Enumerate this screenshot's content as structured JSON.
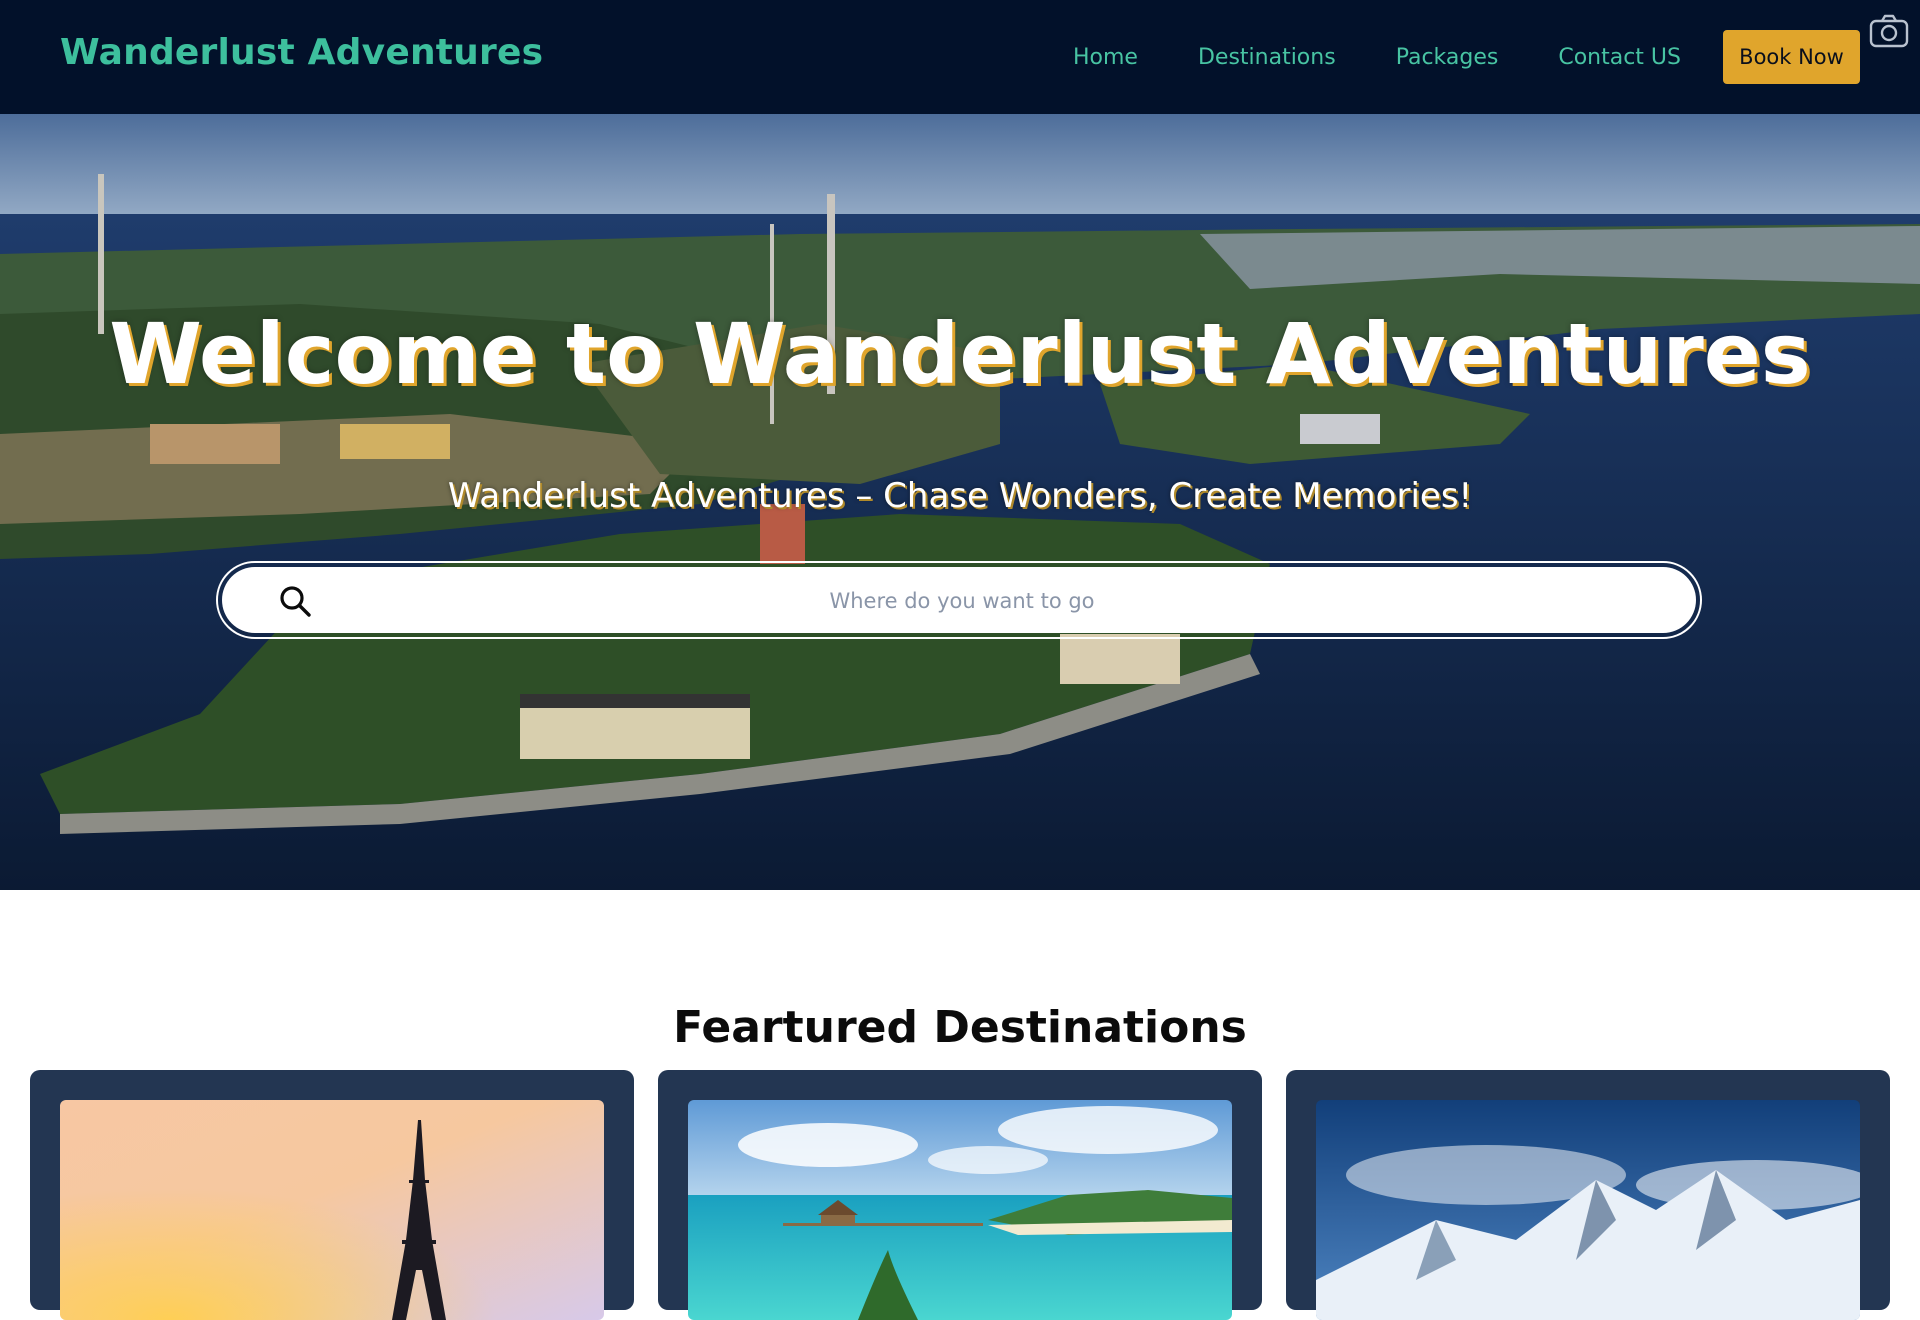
{
  "brand": {
    "name": "Wanderlust Adventures"
  },
  "nav": {
    "links": [
      "Home",
      "Destinations",
      "Packages",
      "Contact US"
    ],
    "cta_label": "Book Now"
  },
  "hero": {
    "title": "Welcome to Wanderlust Adventures",
    "subtitle": "Wanderlust Adventures – Chase Wonders, Create Memories!",
    "search_placeholder": "Where do you want to go"
  },
  "featured": {
    "title": "Feartured Destinations"
  },
  "colors": {
    "nav_bg": "#02112a",
    "brand_teal": "#3dbf9d",
    "cta_gold": "#e0a52c",
    "card_bg": "#233652"
  },
  "icons": {
    "camera": "camera-icon",
    "search": "search-icon"
  }
}
